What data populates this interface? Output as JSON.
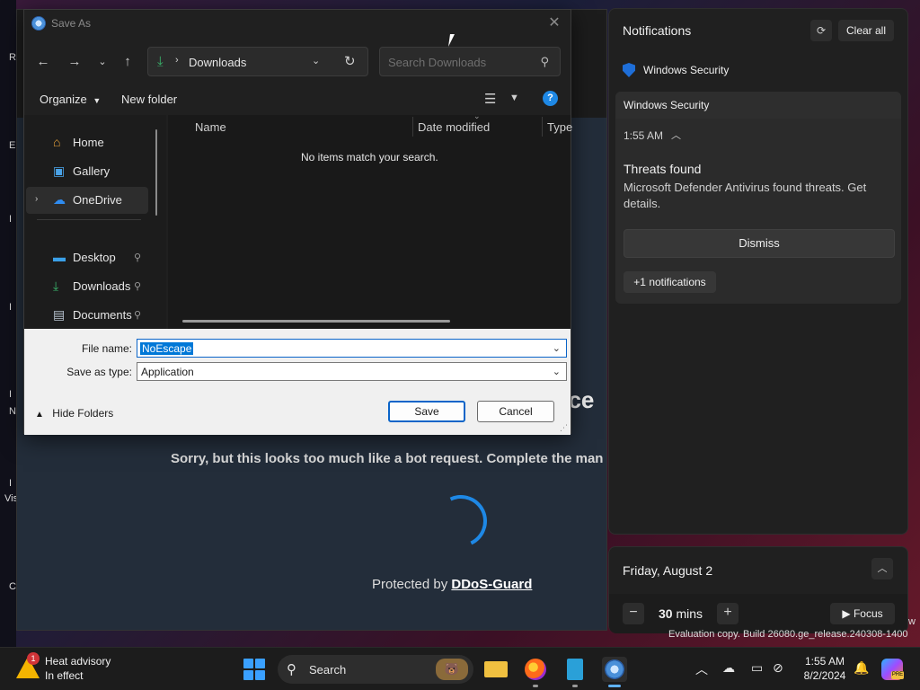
{
  "desktop": {
    "icon_letters": [
      "R",
      "E",
      "I",
      "I",
      "I",
      "N",
      "I",
      "Vis",
      "C"
    ]
  },
  "browser": {
    "heading_fragment": "cce",
    "message": "Sorry, but this looks too much like a bot request. Complete the man",
    "protected_prefix": "Protected by",
    "protected_brand": "DDoS-Guard"
  },
  "dialog": {
    "title": "Save As",
    "address": {
      "location": "Downloads"
    },
    "search": {
      "placeholder": "Search Downloads"
    },
    "command_bar": {
      "organize": "Organize",
      "new_folder": "New folder"
    },
    "nav_items": [
      {
        "label": "Home",
        "icon": "home-icon"
      },
      {
        "label": "Gallery",
        "icon": "gallery-icon"
      },
      {
        "label": "OneDrive",
        "icon": "onedrive-icon",
        "selected": true
      },
      {
        "label": "Desktop",
        "icon": "desktop-icon",
        "pinned": true
      },
      {
        "label": "Downloads",
        "icon": "download-icon",
        "pinned": true
      },
      {
        "label": "Documents",
        "icon": "documents-icon",
        "pinned": true
      }
    ],
    "columns": [
      "Name",
      "Date modified",
      "Type"
    ],
    "empty_message": "No items match your search.",
    "file_name_label": "File name:",
    "file_name_value": "NoEscape",
    "save_type_label": "Save as type:",
    "save_type_value": "Application",
    "hide_folders": "Hide Folders",
    "save_button": "Save",
    "cancel_button": "Cancel"
  },
  "notifications": {
    "title": "Notifications",
    "clear_all": "Clear all",
    "group_app": "Windows Security",
    "card": {
      "app": "Windows Security",
      "time": "1:55 AM",
      "title": "Threats found",
      "body": "Microsoft Defender Antivirus found threats. Get details.",
      "dismiss": "Dismiss",
      "more": "+1 notifications"
    }
  },
  "calendar": {
    "date": "Friday, August 2",
    "focus_minutes": "30",
    "focus_unit": "mins",
    "focus_button": "Focus"
  },
  "watermark": {
    "text": "Evaluation copy. Build 26080.ge_release.240308-1400",
    "edge_letter": "w"
  },
  "taskbar": {
    "weather_title": "Heat advisory",
    "weather_sub": "In effect",
    "weather_badge": "1",
    "search_placeholder": "Search",
    "clock_time": "1:55 AM",
    "clock_date": "8/2/2024"
  },
  "colors": {
    "accent": "#1e88e5",
    "selection": "#0078d7",
    "shield": "#1e6ed8",
    "download_green": "#3ab36b"
  }
}
